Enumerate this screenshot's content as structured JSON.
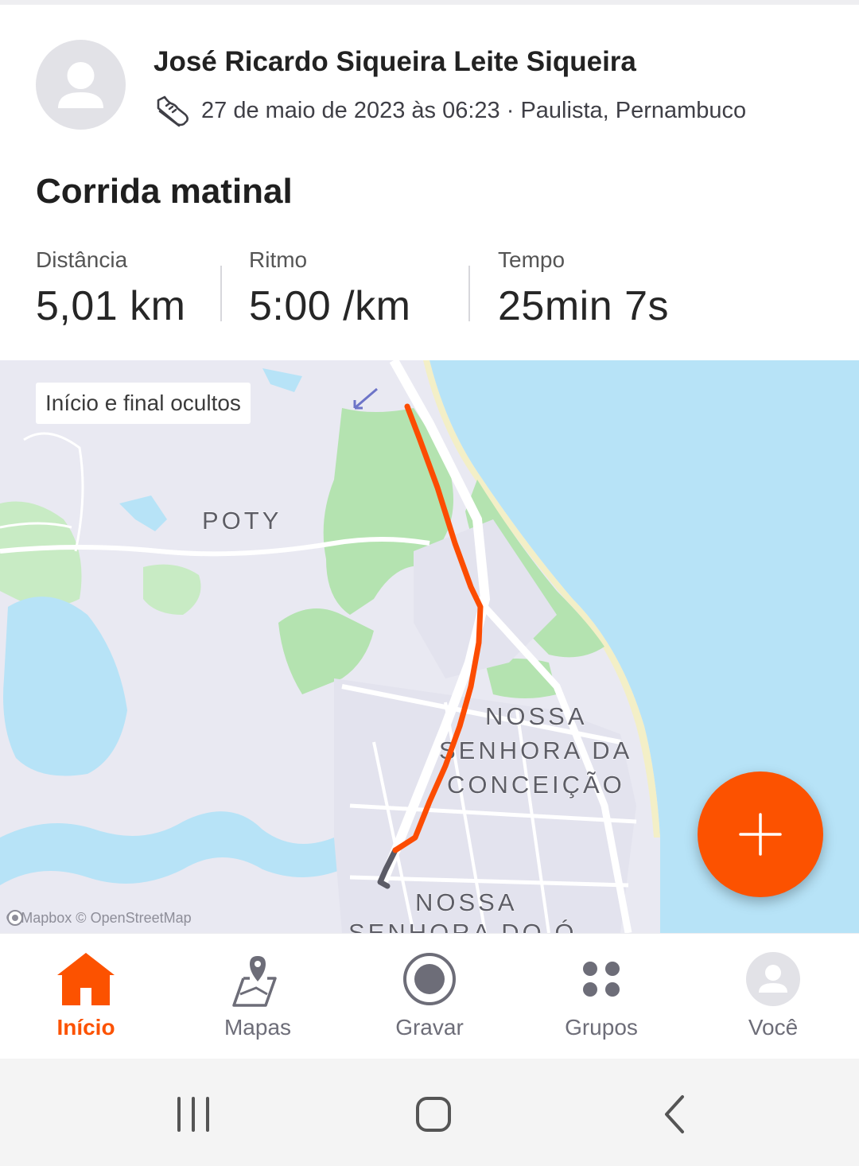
{
  "header": {
    "athlete_name": "José Ricardo Siqueira Leite Siqueira",
    "activity_meta": "27 de maio de 2023 às 06:23 · Paulista, Pernambuco",
    "activity_title": "Corrida matinal"
  },
  "stats": [
    {
      "label": "Distância",
      "value": "5,01 km"
    },
    {
      "label": "Ritmo",
      "value": "5:00 /km"
    },
    {
      "label": "Tempo",
      "value": "25min 7s"
    }
  ],
  "map": {
    "privacy_badge": "Início e final ocultos",
    "places": [
      "POTY",
      "NOSSA",
      "SENHORA DA",
      "CONCEIÇÃO",
      "NOSSA",
      "SENHORA DO Ó"
    ],
    "attribution": "© Mapbox © OpenStreetMap",
    "route_color": "#fc4c02",
    "hidden_segment_color": "#5b5b66",
    "water_color": "#b7e3f7",
    "park_color": "#b4e3b0",
    "land_color": "#e9e9f2"
  },
  "fab": {
    "icon": "plus-icon",
    "color": "#fc5200"
  },
  "tabbar": {
    "items": [
      {
        "label": "Início",
        "icon": "home-icon",
        "active": true
      },
      {
        "label": "Mapas",
        "icon": "map-pin-icon",
        "active": false
      },
      {
        "label": "Gravar",
        "icon": "record-icon",
        "active": false
      },
      {
        "label": "Grupos",
        "icon": "groups-icon",
        "active": false
      },
      {
        "label": "Você",
        "icon": "profile-icon",
        "active": false
      }
    ],
    "active_color": "#fc5200"
  },
  "system_nav": {
    "buttons": [
      "recent-apps-icon",
      "home-button-icon",
      "back-icon"
    ]
  }
}
